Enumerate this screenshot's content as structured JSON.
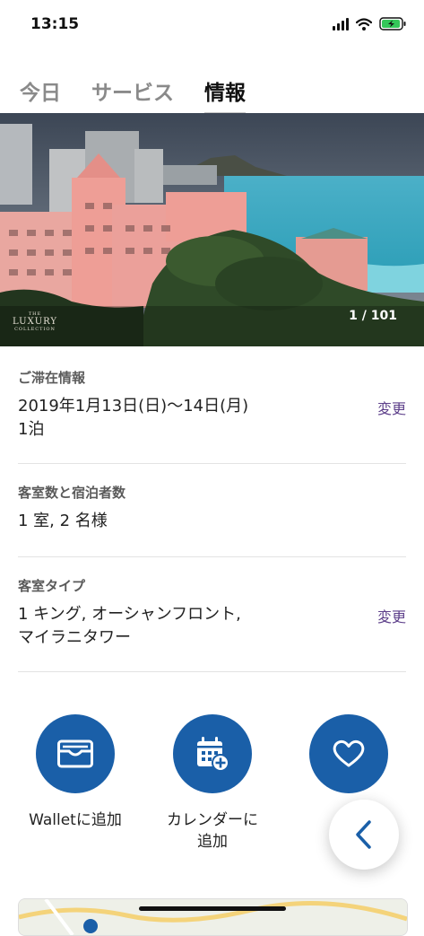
{
  "status_bar": {
    "time": "13:15"
  },
  "tabs": [
    {
      "label": "今日",
      "active": false
    },
    {
      "label": "サービス",
      "active": false
    },
    {
      "label": "情報",
      "active": true
    }
  ],
  "hero": {
    "counter": "1 / 101",
    "logo_small": "THE",
    "logo_main": "LUXURY",
    "logo_sub": "COLLECTION"
  },
  "stay": {
    "label": "ご滞在情報",
    "dates": "2019年1月13日(日)〜14日(月)",
    "nights": "1泊",
    "change": "変更"
  },
  "guests": {
    "label": "客室数と宿泊者数",
    "value": "1 室, 2 名様"
  },
  "room": {
    "label": "客室タイプ",
    "line1": "1 キング, オーシャンフロント,",
    "line2": "マイラニタワー",
    "change": "変更"
  },
  "actions": [
    {
      "icon": "wallet-icon",
      "label": "Walletに追加"
    },
    {
      "icon": "calendar-add-icon",
      "label1": "カレンダーに",
      "label2": "追加"
    },
    {
      "icon": "heart-icon",
      "label1": "…",
      "label2": "…"
    }
  ],
  "colors": {
    "accent_blue": "#1a5fa8",
    "link_purple": "#5d3f8a"
  }
}
